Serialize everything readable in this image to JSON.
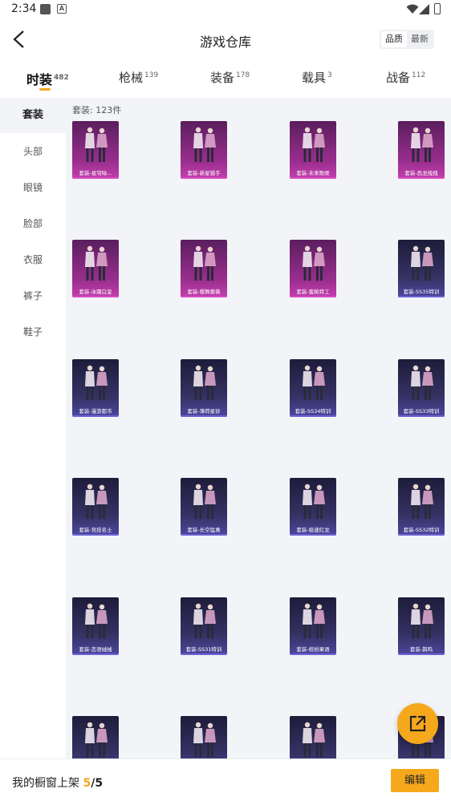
{
  "status_bar": {
    "time": "2:34",
    "a_icon_letter": "A"
  },
  "header": {
    "title": "游戏仓库",
    "sort_options": [
      "品质",
      "最新"
    ],
    "active_sort": "品质"
  },
  "tabs": [
    {
      "label": "时装",
      "count": "482",
      "active": true
    },
    {
      "label": "枪械",
      "count": "139",
      "active": false
    },
    {
      "label": "装备",
      "count": "178",
      "active": false
    },
    {
      "label": "载具",
      "count": "3",
      "active": false
    },
    {
      "label": "战备",
      "count": "112",
      "active": false
    }
  ],
  "sidebar": {
    "items": [
      {
        "label": "套装",
        "active": true
      },
      {
        "label": "头部",
        "active": false
      },
      {
        "label": "眼镜",
        "active": false
      },
      {
        "label": "脸部",
        "active": false
      },
      {
        "label": "衣服",
        "active": false
      },
      {
        "label": "裤子",
        "active": false
      },
      {
        "label": "鞋子",
        "active": false
      }
    ]
  },
  "content": {
    "count_label": "套装: 123件",
    "items": [
      {
        "label": "套装-星穹咏...",
        "rarity": "purple"
      },
      {
        "label": "套装-新星猎手",
        "rarity": "purple"
      },
      {
        "label": "套装-未来歌姬",
        "rarity": "purple"
      },
      {
        "label": "套装-恐龙拽拽",
        "rarity": "purple"
      },
      {
        "label": "套装-冰霜白皇",
        "rarity": "purple"
      },
      {
        "label": "套装-蝶舞蔷薇",
        "rarity": "purple"
      },
      {
        "label": "套装-蜜桃特工",
        "rarity": "purple"
      },
      {
        "label": "套装-SS35特训",
        "rarity": "blue"
      },
      {
        "label": "套装-漫游都市",
        "rarity": "blue"
      },
      {
        "label": "套装-薄荷星砂",
        "rarity": "blue"
      },
      {
        "label": "套装-SS34特训",
        "rarity": "blue"
      },
      {
        "label": "套装-SS33特训",
        "rarity": "blue"
      },
      {
        "label": "套装-竞技名士",
        "rarity": "blue"
      },
      {
        "label": "套装-长空猛禽",
        "rarity": "blue"
      },
      {
        "label": "套装-极速红龙",
        "rarity": "blue"
      },
      {
        "label": "套装-SS32特训",
        "rarity": "blue"
      },
      {
        "label": "套装-恋语绒绒",
        "rarity": "blue"
      },
      {
        "label": "套装-SS31特训",
        "rarity": "blue"
      },
      {
        "label": "套装-缤纷果语",
        "rarity": "blue"
      },
      {
        "label": "套装-鹊鸣",
        "rarity": "blue"
      },
      {
        "label": "",
        "rarity": "blue"
      },
      {
        "label": "",
        "rarity": "blue"
      },
      {
        "label": "",
        "rarity": "blue"
      },
      {
        "label": "",
        "rarity": "blue"
      }
    ]
  },
  "fab": {
    "icon": "share-icon"
  },
  "bottom_bar": {
    "showcase_label": "我的橱窗上架",
    "showcase_count": "5",
    "showcase_separator": "/",
    "showcase_total": "5",
    "edit_label": "编辑"
  },
  "colors": {
    "accent": "#f6a81c",
    "rarity_purple": "#c33fae",
    "rarity_blue": "#4b47a0",
    "content_bg": "#f2f4f8"
  }
}
